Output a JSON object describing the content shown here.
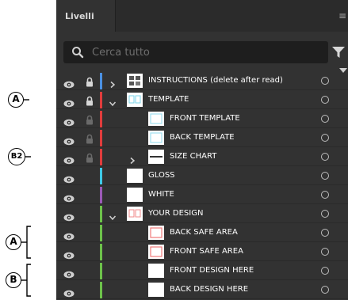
{
  "panel": {
    "tab_label": "Livelli",
    "search_placeholder": "Cerca tutto"
  },
  "colors": {
    "panel_bg": "#323232",
    "blue": "#4a90e2",
    "red": "#e03c3c",
    "cyan": "#3ec9e6",
    "purple": "#9b59b6",
    "green": "#6dc24a"
  },
  "layers": [
    {
      "name": "INSTRUCTIONS (delete after read)",
      "color": "blue",
      "locked": true,
      "lock_dim": false,
      "chevron": "right",
      "indent": 0,
      "thumb": "instructions"
    },
    {
      "name": "TEMPLATE",
      "color": "red",
      "locked": true,
      "lock_dim": false,
      "chevron": "down",
      "indent": 0,
      "thumb": "template"
    },
    {
      "name": "FRONT TEMPLATE",
      "color": "red",
      "locked": true,
      "lock_dim": true,
      "chevron": "",
      "indent": 1,
      "thumb": "cyanbox"
    },
    {
      "name": "BACK TEMPLATE",
      "color": "red",
      "locked": true,
      "lock_dim": true,
      "chevron": "",
      "indent": 1,
      "thumb": "cyanbox"
    },
    {
      "name": "SIZE CHART",
      "color": "red",
      "locked": true,
      "lock_dim": true,
      "chevron": "right",
      "indent": 1,
      "thumb": "sizechart"
    },
    {
      "name": "GLOSS",
      "color": "cyan",
      "locked": false,
      "lock_dim": false,
      "chevron": "",
      "indent": 0,
      "thumb": "white"
    },
    {
      "name": "WHITE",
      "color": "purple",
      "locked": false,
      "lock_dim": false,
      "chevron": "",
      "indent": 0,
      "thumb": "white"
    },
    {
      "name": "YOUR DESIGN",
      "color": "green",
      "locked": false,
      "lock_dim": false,
      "chevron": "down",
      "indent": 0,
      "thumb": "yourdesign"
    },
    {
      "name": "BACK SAFE AREA",
      "color": "green",
      "locked": false,
      "lock_dim": false,
      "chevron": "",
      "indent": 1,
      "thumb": "redbox"
    },
    {
      "name": "FRONT SAFE AREA",
      "color": "green",
      "locked": false,
      "lock_dim": false,
      "chevron": "",
      "indent": 1,
      "thumb": "redbox"
    },
    {
      "name": "FRONT DESIGN HERE",
      "color": "green",
      "locked": false,
      "lock_dim": false,
      "chevron": "",
      "indent": 1,
      "thumb": "white"
    },
    {
      "name": "BACK DESIGN HERE",
      "color": "green",
      "locked": false,
      "lock_dim": false,
      "chevron": "",
      "indent": 1,
      "thumb": "white"
    }
  ],
  "callouts": [
    {
      "text": "A",
      "row": 1,
      "bracket": false
    },
    {
      "text": "B2",
      "row": 4,
      "bracket": false
    },
    {
      "text": "A",
      "row": 8,
      "rows_span": 2,
      "bracket": true
    },
    {
      "text": "B",
      "row": 10,
      "rows_span": 2,
      "bracket": true
    }
  ]
}
